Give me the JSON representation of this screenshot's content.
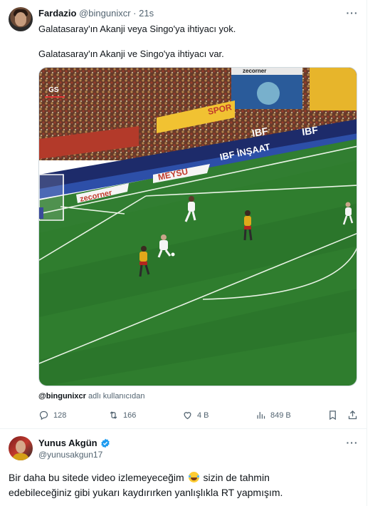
{
  "tweet": {
    "author_name": "Fardazio",
    "author_handle": "@bingunixcr",
    "separator": "·",
    "time": "21s",
    "line1": "Galatasaray'ın Akanji veya Singo'ya ihtiyacı yok.",
    "line2": "Galatasaray'ın Akanji ve Singo'ya ihtiyacı var.",
    "media": {
      "broadcast_logo": "GS",
      "ads": [
        "zecorner",
        "IBF",
        "IBF",
        "IBF İNŞAAT",
        "MEYSU",
        "zecorner",
        "SPOR"
      ]
    },
    "credit_handle": "@bingunixcr",
    "credit_suffix": "adlı kullanıcıdan",
    "stats": {
      "replies": "128",
      "retweets": "166",
      "likes": "4 B",
      "views": "849 B"
    }
  },
  "reply": {
    "author_name": "Yunus Akgün",
    "verified": true,
    "author_handle": "@yunusakgun17",
    "line1_before": "Bir daha bu sitede video izlemeyeceğim",
    "line1_after": "sizin de tahmin",
    "line2": "edebileceğiniz gibi yukarı kaydırırken yanlışlıkla RT yapmışım."
  },
  "icons": {
    "more": "more-horizontal-icon",
    "reply": "reply-icon",
    "retweet": "retweet-icon",
    "like": "heart-icon",
    "views": "views-icon",
    "bookmark": "bookmark-icon",
    "share": "share-icon",
    "verified": "verified-badge-icon",
    "emoji": "tears-of-joy-emoji-icon"
  },
  "colors": {
    "text_primary": "#0f1419",
    "text_secondary": "#536471",
    "verified_blue": "#1d9bf0",
    "pitch_green": "#2f7d2e"
  }
}
